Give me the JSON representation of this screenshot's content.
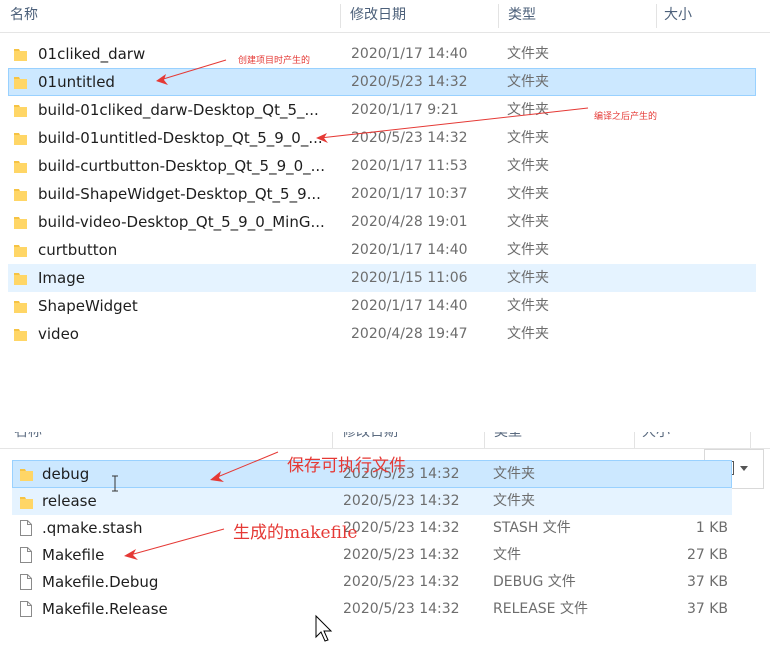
{
  "columns": {
    "name": "名称",
    "date": "修改日期",
    "type": "类型",
    "size": "大小"
  },
  "top_list": [
    {
      "name": "01cliked_darw",
      "date": "2020/1/17 14:40",
      "type": "文件夹",
      "state": "normal"
    },
    {
      "name": "01untitled",
      "date": "2020/5/23 14:32",
      "type": "文件夹",
      "state": "selected"
    },
    {
      "name": "build-01cliked_darw-Desktop_Qt_5_...",
      "date": "2020/1/17 9:21",
      "type": "文件夹",
      "state": "normal"
    },
    {
      "name": "build-01untitled-Desktop_Qt_5_9_0_...",
      "date": "2020/5/23 14:32",
      "type": "文件夹",
      "state": "normal"
    },
    {
      "name": "build-curtbutton-Desktop_Qt_5_9_0_...",
      "date": "2020/1/17 11:53",
      "type": "文件夹",
      "state": "normal"
    },
    {
      "name": "build-ShapeWidget-Desktop_Qt_5_9...",
      "date": "2020/1/17 10:37",
      "type": "文件夹",
      "state": "normal"
    },
    {
      "name": "build-video-Desktop_Qt_5_9_0_MinG...",
      "date": "2020/4/28 19:01",
      "type": "文件夹",
      "state": "normal"
    },
    {
      "name": "curtbutton",
      "date": "2020/1/17 14:40",
      "type": "文件夹",
      "state": "normal"
    },
    {
      "name": "Image",
      "date": "2020/1/15 11:06",
      "type": "文件夹",
      "state": "hover"
    },
    {
      "name": "ShapeWidget",
      "date": "2020/1/17 14:40",
      "type": "文件夹",
      "state": "normal"
    },
    {
      "name": "video",
      "date": "2020/4/28 19:47",
      "type": "文件夹",
      "state": "normal"
    }
  ],
  "bottom_list": [
    {
      "name": "debug",
      "date": "2020/5/23 14:32",
      "type": "文件夹",
      "size": "",
      "kind": "folder",
      "state": "selected"
    },
    {
      "name": "release",
      "date": "2020/5/23 14:32",
      "type": "文件夹",
      "size": "",
      "kind": "folder",
      "state": "hover"
    },
    {
      "name": ".qmake.stash",
      "date": "2020/5/23 14:32",
      "type": "STASH 文件",
      "size": "1 KB",
      "kind": "file",
      "state": "normal"
    },
    {
      "name": "Makefile",
      "date": "2020/5/23 14:32",
      "type": "文件",
      "size": "27 KB",
      "kind": "file",
      "state": "normal"
    },
    {
      "name": "Makefile.Debug",
      "date": "2020/5/23 14:32",
      "type": "DEBUG 文件",
      "size": "37 KB",
      "kind": "file",
      "state": "normal"
    },
    {
      "name": "Makefile.Release",
      "date": "2020/5/23 14:32",
      "type": "RELEASE 文件",
      "size": "37 KB",
      "kind": "file",
      "state": "normal"
    }
  ],
  "annotations": {
    "create_project": "创建项目时产生的",
    "after_compile": "编译之后产生的",
    "save_executable": "保存可执行文件",
    "makefile_generated": "生成的makefile"
  },
  "colors": {
    "selected_bg": "#cce8ff",
    "selected_border": "#99d1ff",
    "hover_bg": "#e5f3ff",
    "annotation": "#e53935",
    "folder": "#f6c343",
    "header_text": "#4c607a"
  },
  "icons": {
    "folder": "folder-icon",
    "file": "file-icon",
    "image_view": "image-icon",
    "cursor": "mouse-cursor-icon"
  }
}
